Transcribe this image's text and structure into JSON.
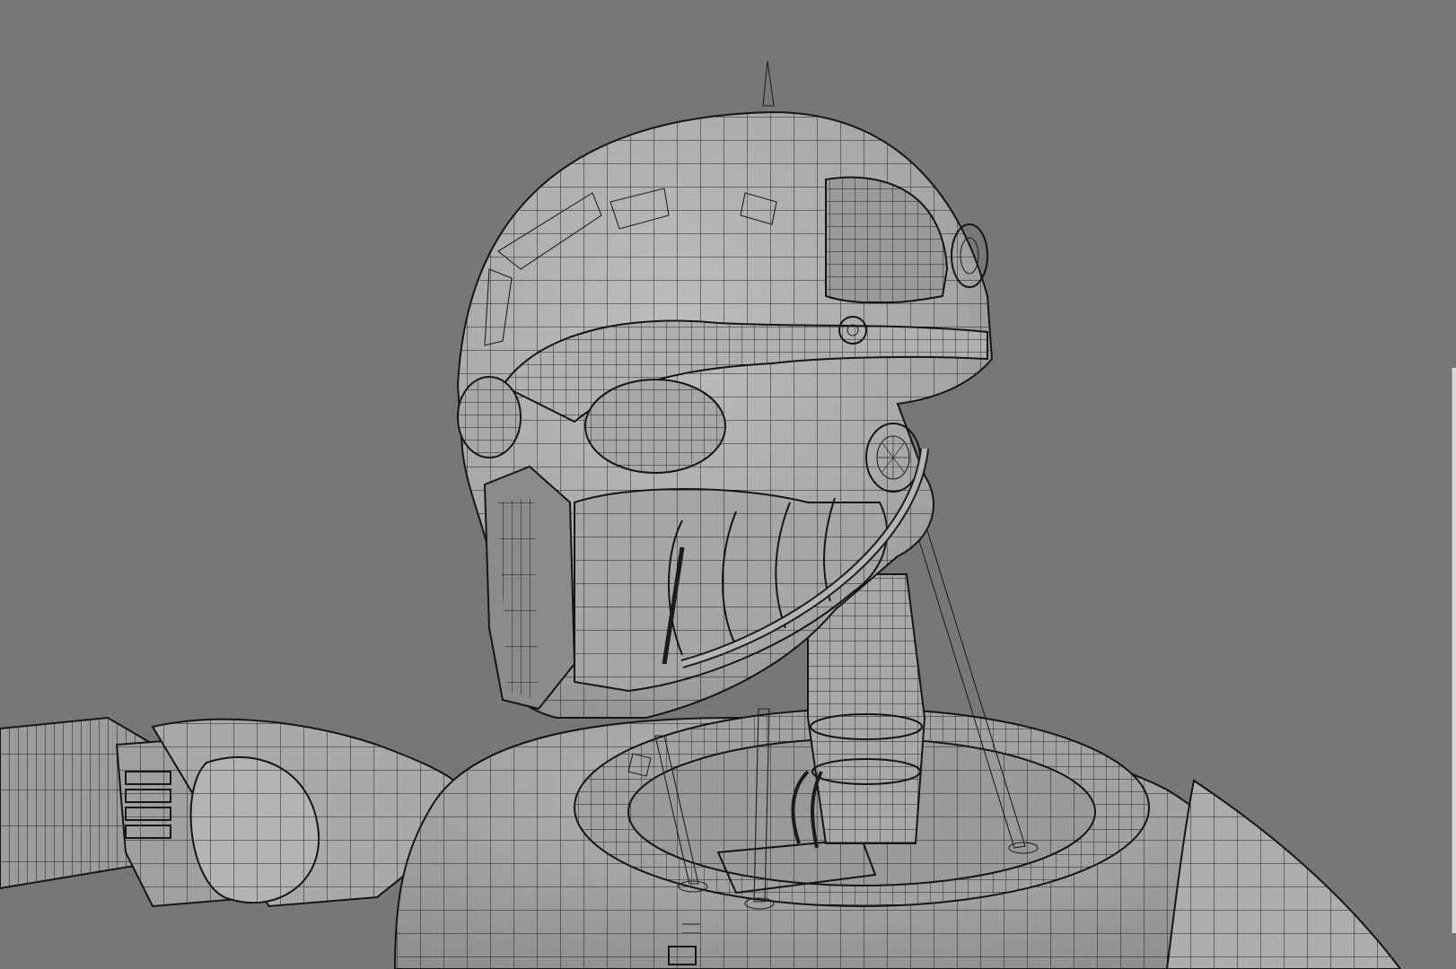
{
  "viewport": {
    "background_color": "#777777",
    "surface_color": "#a9a9a9",
    "surface_shadow_color": "#8d8d8d",
    "wire_color": "#202020",
    "render_mode": "wireframe-on-shaded"
  },
  "model": {
    "parts": [
      "head",
      "antenna",
      "ear-ring",
      "eye-left",
      "eye-right",
      "jaw",
      "neck",
      "neck-rods",
      "collar",
      "shoulder-left",
      "arm-left",
      "shoulder-right"
    ]
  }
}
